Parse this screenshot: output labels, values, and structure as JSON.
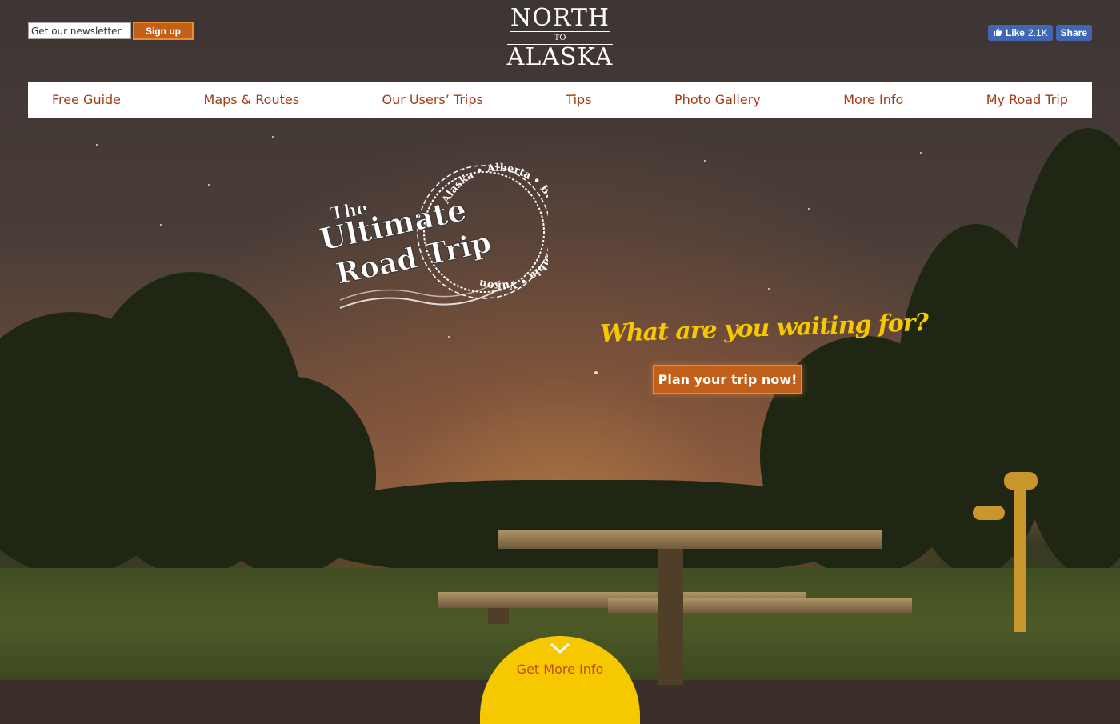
{
  "newsletter": {
    "placeholder": "Get our newsletter",
    "button_label": "Sign up"
  },
  "logo": {
    "line1": "NORTH",
    "line2": "TO",
    "line3": "ALASKA"
  },
  "facebook": {
    "like_label": "Like",
    "like_count": "2.1K",
    "share_label": "Share"
  },
  "nav": {
    "items": [
      {
        "label": "Free Guide"
      },
      {
        "label": "Maps & Routes"
      },
      {
        "label": "Our Users’ Trips"
      },
      {
        "label": "Tips"
      },
      {
        "label": "Photo Gallery"
      },
      {
        "label": "More Info"
      },
      {
        "label": "My Road Trip"
      }
    ]
  },
  "stamp": {
    "the": "The",
    "ultimate": "Ultimate",
    "road_trip": "Road Trip",
    "regions": "Alaska • Alberta • British Columbia • Yukon"
  },
  "hero": {
    "tagline": "What are you waiting for?",
    "cta_label": "Plan your trip now!"
  },
  "more_info": {
    "label": "Get More Info"
  },
  "colors": {
    "accent": "#c0601a",
    "nav_text": "#a53a14",
    "tagline": "#f5c800",
    "facebook": "#4267b2"
  }
}
